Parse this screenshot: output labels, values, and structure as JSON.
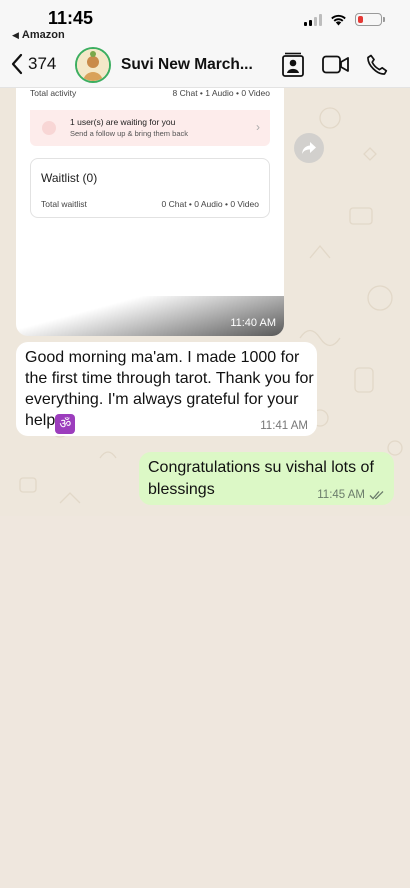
{
  "status_bar": {
    "time": "11:45",
    "back_app": "Amazon"
  },
  "header": {
    "back_count": "374",
    "chat_title": "Suvi New March..."
  },
  "messages": {
    "card": {
      "total_activity_label": "Total activity",
      "total_activity_value": "8 Chat • 1 Audio • 0 Video",
      "waiting_title": "1 user(s) are waiting for you",
      "waiting_sub": "Send a follow up & bring them back",
      "waitlist_title": "Waitlist (0)",
      "total_waitlist_label": "Total waitlist",
      "total_waitlist_value": "0 Chat • 0 Audio • 0 Video",
      "time": "11:40 AM"
    },
    "incoming": {
      "text": "Good morning ma'am. I made 1000 for the first time through tarot. Thank you for everything. I'm always grateful for your help",
      "emoji": "ॐ",
      "time": "11:41 AM"
    },
    "outgoing": {
      "text": "Congratulations su vishal lots of blessings",
      "time": "11:45 AM"
    }
  },
  "colors": {
    "outgoing_bubble": "#dcf8c6",
    "incoming_bubble": "#ffffff",
    "chat_bg": "#eee7dc",
    "avatar_ring": "#3cae60",
    "battery_low": "#e53935"
  },
  "icons": {
    "back": "chevron-left-icon",
    "contact_card": "contact-card-icon",
    "video": "video-call-icon",
    "phone": "phone-icon",
    "forward": "forward-icon",
    "read_receipt": "double-check-icon"
  }
}
